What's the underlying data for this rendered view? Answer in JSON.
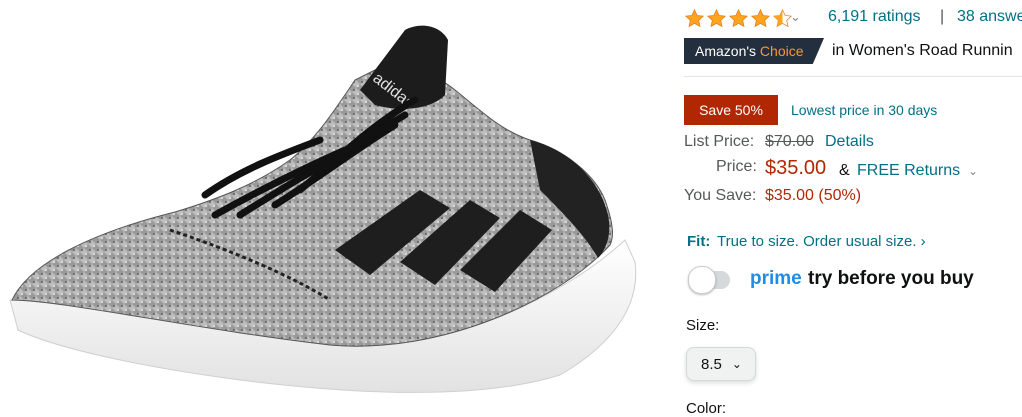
{
  "rating": {
    "stars": 4.5,
    "count_label": "6,191 ratings",
    "separator": "|",
    "answers_label": "38 answe"
  },
  "choice": {
    "prefix": "Amazon's",
    "highlight": "Choice",
    "category_text": "in Women's Road Runnin"
  },
  "deal": {
    "badge": "Save 50%",
    "note": "Lowest price in 30 days"
  },
  "pricing": {
    "list_label": "List Price:",
    "list_value": "$70.00",
    "details_link": "Details",
    "price_label": "Price:",
    "price_value": "$35.00",
    "amp": "&",
    "returns_link": "FREE Returns",
    "save_label": "You Save:",
    "save_value": "$35.00 (50%)"
  },
  "fit": {
    "label": "Fit:",
    "text": "True to size. Order usual size. ›"
  },
  "prime": {
    "word": "prime",
    "text": "try before you buy",
    "toggle_on": false
  },
  "size": {
    "label": "Size:",
    "selected": "8.5"
  },
  "color": {
    "label": "Color:"
  },
  "image": {
    "brand_text": "adidas"
  },
  "colors": {
    "link": "#007185",
    "price": "#b12704",
    "star": "#ffa41c",
    "badge_dark": "#232f3e",
    "choice_orange": "#f69931",
    "prime_blue": "#1f8ce6"
  }
}
